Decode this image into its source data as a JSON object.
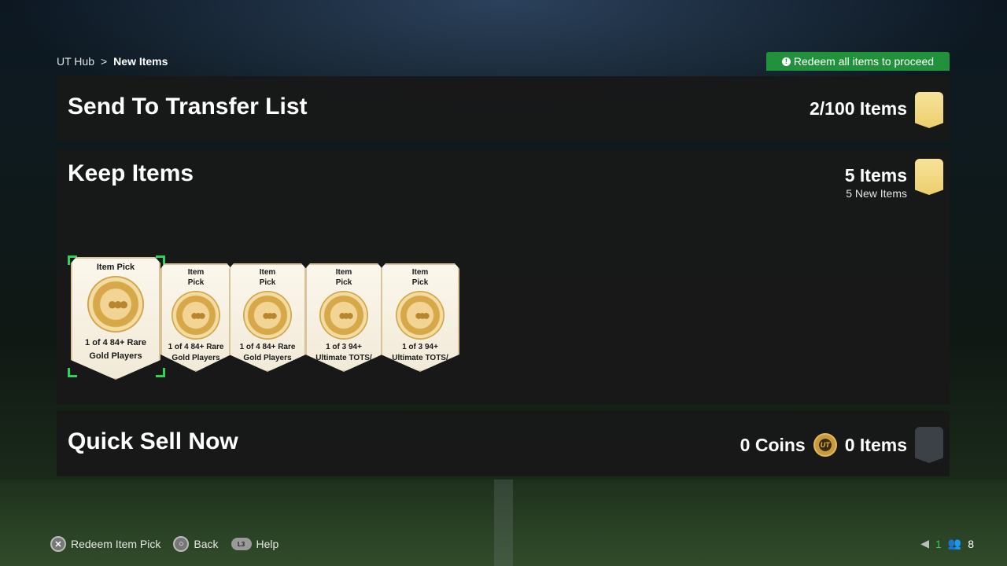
{
  "breadcrumb": {
    "root": "UT Hub",
    "separator": ">",
    "current": "New Items"
  },
  "notice": {
    "text": "Redeem all items to proceed",
    "icon": "info-icon",
    "color": "#21913b"
  },
  "transfer": {
    "title": "Send To Transfer List",
    "count": "2/100 Items"
  },
  "keep": {
    "title": "Keep Items",
    "count": "5 Items",
    "sub": "5 New Items",
    "cards": [
      {
        "top": "Item Pick",
        "desc1": "1 of 4 84+ Rare",
        "desc2": "Gold Players",
        "selected": true
      },
      {
        "top": "Item Pick",
        "desc1": "1 of 4 84+ Rare",
        "desc2": "Gold Players"
      },
      {
        "top": "Item Pick",
        "desc1": "1 of 4 84+ Rare",
        "desc2": "Gold Players"
      },
      {
        "top": "Item Pick",
        "desc1": "1 of 3 94+",
        "desc2": "Ultimate TOTS/"
      },
      {
        "top": "Item Pick",
        "desc1": "1 of 3 94+",
        "desc2": "Ultimate TOTS/"
      }
    ]
  },
  "sell": {
    "title": "Quick Sell Now",
    "coins": "0 Coins",
    "coin_badge": "UT",
    "items": "0 Items"
  },
  "footer": {
    "redeem": {
      "button": "✕",
      "label": "Redeem Item Pick"
    },
    "back": {
      "button": "○",
      "label": "Back"
    },
    "help": {
      "button": "L3",
      "label": "Help"
    }
  },
  "status": {
    "count_a": "1",
    "count_b": "8"
  },
  "colors": {
    "accent_green": "#2fd35c",
    "gold": "#ecce6d"
  }
}
